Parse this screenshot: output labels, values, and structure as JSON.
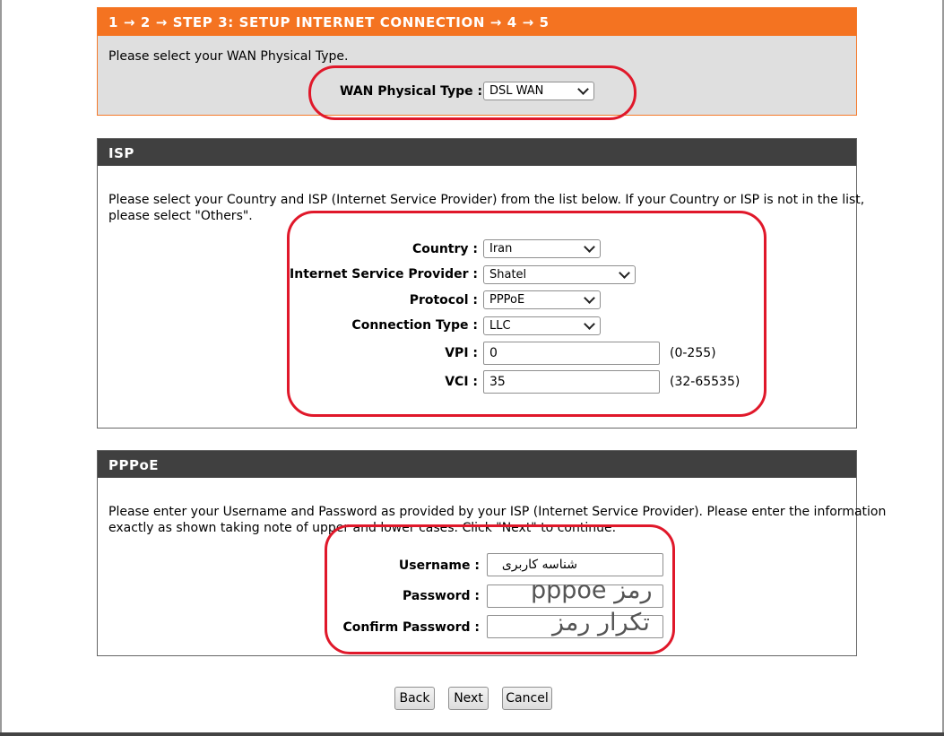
{
  "step_header": "1 → 2 → STEP 3: SETUP INTERNET CONNECTION → 4 → 5",
  "wan": {
    "instruction": "Please select your WAN Physical Type.",
    "label": "WAN Physical Type :",
    "value": "DSL WAN"
  },
  "isp": {
    "title": "ISP",
    "instruction_line1": "Please select your Country and ISP (Internet Service Provider) from the list below. If your Country or ISP is not in the list,",
    "instruction_line2": "please select \"Others\".",
    "country_label": "Country :",
    "country_value": "Iran",
    "provider_label": "Internet Service Provider :",
    "provider_value": "Shatel",
    "protocol_label": "Protocol :",
    "protocol_value": "PPPoE",
    "conn_type_label": "Connection Type :",
    "conn_type_value": "LLC",
    "vpi_label": "VPI :",
    "vpi_value": "0",
    "vpi_range": "(0-255)",
    "vci_label": "VCI :",
    "vci_value": "35",
    "vci_range": "(32-65535)"
  },
  "pppoe": {
    "title": "PPPoE",
    "instruction_line1": "Please enter your Username and Password as provided by your ISP (Internet Service Provider). Please enter the information",
    "instruction_line2": "exactly as shown taking note of upper and lower cases. Click \"Next\" to continue.",
    "username_label": "Username :",
    "username_value": "شناسه کاربری",
    "password_label": "Password :",
    "password_overlay": "رمز pppoe",
    "confirm_label": "Confirm Password :",
    "confirm_overlay": "تکرار رمز"
  },
  "buttons": {
    "back": "Back",
    "next": "Next",
    "cancel": "Cancel"
  },
  "colors": {
    "step_header_bg": "#f47321",
    "section_header_bg": "#404040",
    "annotation_red": "#e0182a"
  }
}
